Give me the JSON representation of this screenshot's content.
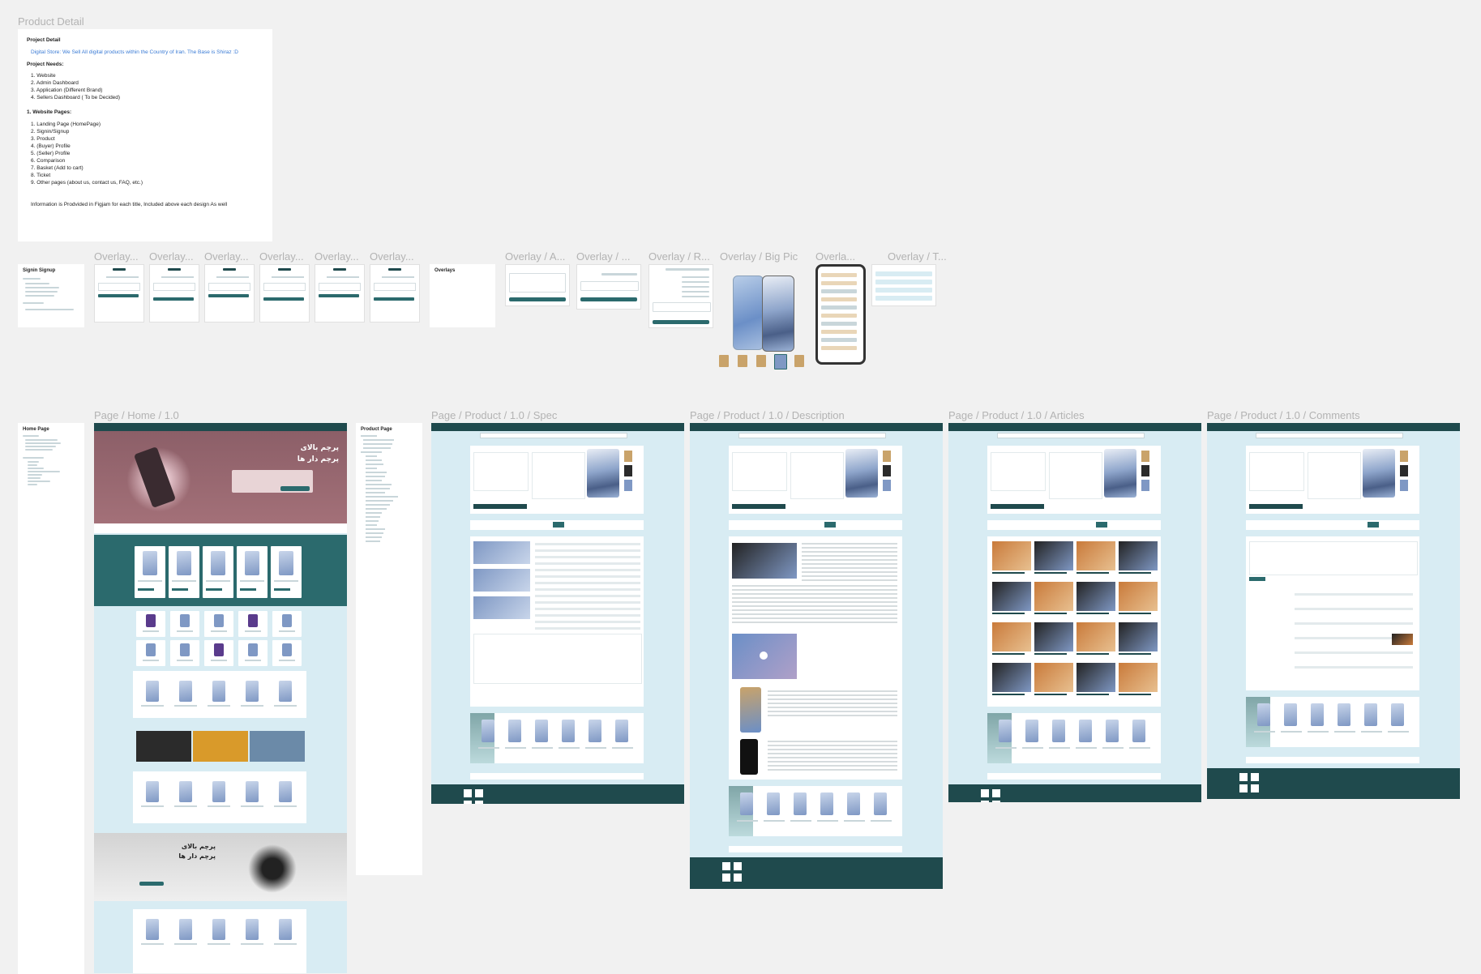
{
  "canvas": {
    "background": "#f1f1f1",
    "accent": "#2b6a6d",
    "dark_teal": "#1f4a4d",
    "light_blue": "#d8ecf3"
  },
  "product_detail": {
    "label": "Product Detail",
    "title": "Project Detail",
    "tagline": "Digital Store: We Sell All digital products within the Country of Iran. The Base is Shiraz :D",
    "needs_title": "Project Needs:",
    "needs": [
      "1. Website",
      "2. Admin Dashboard",
      "3. Application (Different Brand)",
      "4. Sellers Dashboard ( To be Decided)"
    ],
    "pages_title": "1. Website Pages:",
    "pages": [
      "1. Landing Page (HomePage)",
      "2. Signin/Signup",
      "3. Product",
      "4. (Buyer) Profile",
      "5. (Seller) Profile",
      "6. Comparison",
      "7. Basket (Add to cart)",
      "8. Ticket",
      "9. Other pages (about us, contact us, FAQ, etc.)"
    ],
    "footer": "Information is Prodvided in Figjam for each title, Included above each design As well"
  },
  "signin": {
    "title": "Signin Signup"
  },
  "overlay_labels": [
    "Overlay...",
    "Overlay...",
    "Overlay...",
    "Overlay...",
    "Overlay...",
    "Overlay..."
  ],
  "overlays_card": {
    "title": "Overlays"
  },
  "overlay_more": [
    "Overlay / A...",
    "Overlay / ...",
    "Overlay / R...",
    "Overlay / Big Pic",
    "Overla...",
    "Overlay / T..."
  ],
  "home_note": {
    "title": "Home Page"
  },
  "product_note": {
    "title": "Product Page"
  },
  "pages": [
    {
      "label": "Page / Home / 1.0"
    },
    {
      "label": "Page / Product / 1.0 / Spec"
    },
    {
      "label": "Page / Product / 1.0 / Description"
    },
    {
      "label": "Page / Product / 1.0 / Articles"
    },
    {
      "label": "Page / Product / 1.0 / Comments"
    }
  ],
  "banner": {
    "headline_1": "پرچم بالای",
    "headline_2": "پرچم دار ها"
  },
  "icons": [
    "phone-icon",
    "play-icon"
  ]
}
